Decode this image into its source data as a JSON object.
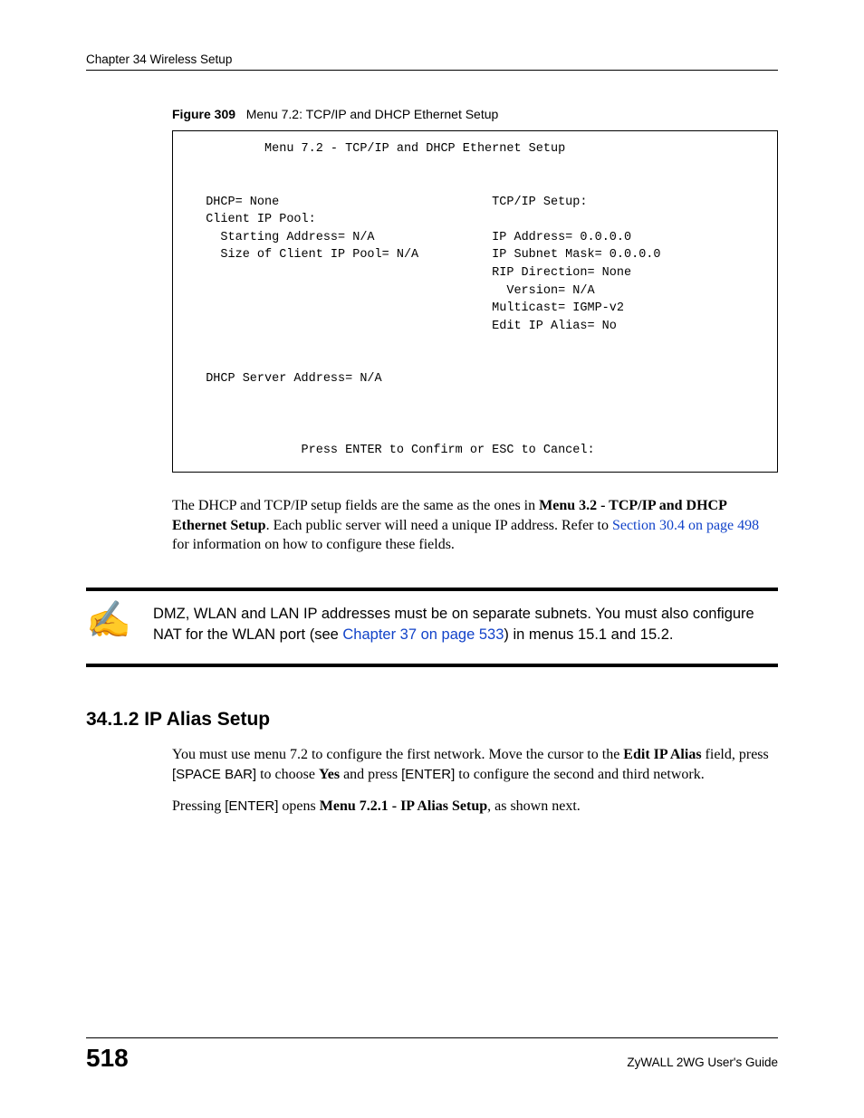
{
  "header": {
    "chapter": "Chapter 34 Wireless Setup"
  },
  "figure": {
    "label": "Figure 309",
    "title": "Menu 7.2: TCP/IP and DHCP Ethernet Setup"
  },
  "terminal": {
    "title": "Menu 7.2 - TCP/IP and DHCP Ethernet Setup",
    "dhcp_label": "DHCP= None",
    "tcpip_label": "TCP/IP Setup:",
    "client_pool_label": "Client IP Pool:",
    "starting_addr": "Starting Address= N/A",
    "ip_address": "IP Address= 0.0.0.0",
    "pool_size": "Size of Client IP Pool= N/A",
    "subnet_mask": "IP Subnet Mask= 0.0.0.0",
    "rip_direction": "RIP Direction= None",
    "rip_version": "Version= N/A",
    "multicast": "Multicast= IGMP-v2",
    "edit_ip_alias": "Edit IP Alias= No",
    "dhcp_server": "DHCP Server Address= N/A",
    "prompt": "Press ENTER to Confirm or ESC to Cancel:"
  },
  "para1": {
    "t1": "The DHCP and TCP/IP setup fields are the same as the ones in ",
    "t2": "Menu 3.2 - TCP/IP and DHCP Ethernet Setup",
    "t3": ". Each public server will need a unique IP address. Refer to ",
    "link": "Section 30.4 on page 498",
    "t4": " for information on how to configure these fields."
  },
  "note": {
    "icon": "✍",
    "t1": "DMZ, WLAN and LAN IP addresses must be on separate subnets. You must also configure NAT for the WLAN port (see ",
    "link": "Chapter 37 on page 533",
    "t2": ") in menus 15.1 and 15.2."
  },
  "section": {
    "heading": "34.1.2  IP Alias Setup",
    "p1_t1": "You must use menu 7.2 to configure the first network. Move the cursor to the ",
    "p1_b1": "Edit IP Alias",
    "p1_t2": " field, press ",
    "p1_s1": "[SPACE BAR]",
    "p1_t3": " to choose ",
    "p1_b2": "Yes",
    "p1_t4": " and press ",
    "p1_s2": "[ENTER]",
    "p1_t5": " to configure the second and third network.",
    "p2_t1": "Pressing ",
    "p2_s1": "[ENTER]",
    "p2_t2": " opens ",
    "p2_b1": "Menu 7.2.1 - IP Alias Setup",
    "p2_t3": ", as shown next."
  },
  "footer": {
    "page": "518",
    "guide": "ZyWALL 2WG User's Guide"
  }
}
